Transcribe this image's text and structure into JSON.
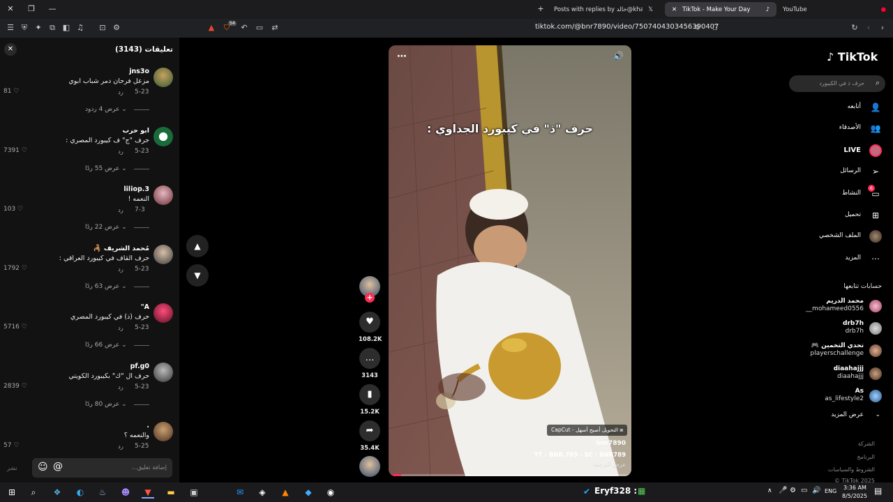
{
  "browser": {
    "tabs": [
      {
        "title": "Posts with replies by خالد@khaled51 (@kh"
      },
      {
        "title": "TikTok - Make Your Day"
      },
      {
        "title": "YouTube"
      }
    ],
    "url": "tiktok.com/@bnr7890/video/7507404303456390407",
    "badge": "54"
  },
  "comments_panel": {
    "title": "تعليقات (3143)",
    "reply_label": "رد",
    "comments": [
      {
        "user": "jns3o",
        "text": "مزعل فرحان دمر شباب ابوي",
        "date": "5-23",
        "likes": "81",
        "view": "عرض 4 ردود"
      },
      {
        "user": "ابو حرب",
        "text": "حرف \"ج\" ف كيبورد المصري :",
        "date": "5-23",
        "likes": "7391",
        "view": "عرض 55 ردًا"
      },
      {
        "user": "liliop.3",
        "text": "النعمه !",
        "date": "7-3",
        "likes": "103",
        "view": "عرض 22 ردًا"
      },
      {
        "user": "مُحمد الشريف 🦂",
        "text": "حرف القاف في كيبورد العراقي :",
        "date": "5-23",
        "likes": "1792",
        "view": "عرض 63 ردًا"
      },
      {
        "user": "A\"",
        "text": "حرف (ذ) في كيبورد المصري",
        "date": "5-23",
        "likes": "5716",
        "view": "عرض 66 ردًا"
      },
      {
        "user": "pf.g0",
        "text": "حرف ال \"ك\" بكيبورد الكويتي",
        "date": "5-23",
        "likes": "2839",
        "view": "عرض 80 ردًا"
      },
      {
        "user": ".",
        "text": "والنعمه ؟",
        "date": "5-25",
        "likes": "57",
        "view": ""
      }
    ],
    "input_placeholder": "إضافة تعليق...",
    "post_label": "نشر"
  },
  "video": {
    "caption": "حرف \"ذ\" في كيبورد الجداوي :",
    "capcut_text": "CapCut - التحويل أصبح أسهل",
    "author": "bnr7890",
    "description": "YT : BNR.789 - SC : BNR789",
    "see_translation": "عرض الترجمة"
  },
  "actions": {
    "likes": "108.2K",
    "comments": "3143",
    "saves": "15.2K",
    "shares": "35.4K"
  },
  "sidebar": {
    "logo": "TikTok",
    "search_placeholder": "حرف ذ في الكيبورد",
    "nav": [
      {
        "label": "أتابعه",
        "icon": "user-follow-icon"
      },
      {
        "label": "الأصدقاء",
        "icon": "friends-icon"
      },
      {
        "label": "LIVE",
        "icon": "live-icon"
      },
      {
        "label": "الرسائل",
        "icon": "messages-icon"
      },
      {
        "label": "النشاط",
        "icon": "activity-icon"
      },
      {
        "label": "تحميل",
        "icon": "upload-icon"
      },
      {
        "label": "الملف الشخصي",
        "icon": "profile-icon"
      },
      {
        "label": "المزيد",
        "icon": "more-icon"
      }
    ],
    "activity_badge": "6",
    "following_title": "حسابات تتابعها",
    "following": [
      {
        "name": "محمد الدريم",
        "handle": "__mohameed0556"
      },
      {
        "name": "drb7h",
        "handle": "drb7h"
      },
      {
        "name": "تحدي التخمين 🎮",
        "handle": "playerschallenge"
      },
      {
        "name": "diaahajjj",
        "handle": "diaahajjj"
      },
      {
        "name": "As",
        "handle": "as_lifestyle2"
      }
    ],
    "see_more": "عرض المزيد",
    "footer": [
      "الشركة",
      "البرنامج",
      "الشروط والسياسات",
      "© TikTok 2025"
    ]
  },
  "taskbar": {
    "media_text": "Eryf328 :",
    "lang": "ENG",
    "time": "3:36 AM",
    "date": "8/5/2025"
  }
}
